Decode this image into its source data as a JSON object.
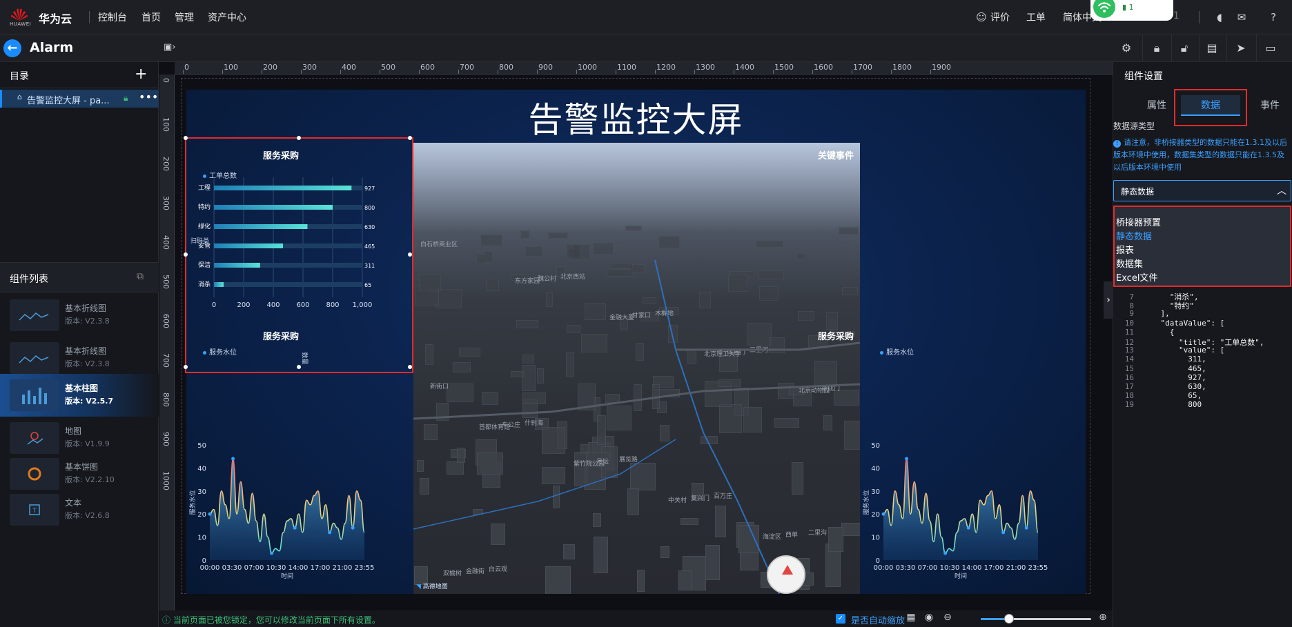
{
  "topbar": {
    "logo_text": "HUAWEI",
    "brand": "华为云",
    "nav": [
      "控制台",
      "首页",
      "管理",
      "资产中心"
    ],
    "rate_label": "评价",
    "ticket_label": "工单",
    "lang_label": "简体中文",
    "account_tail": "51",
    "wifi_badge": "1"
  },
  "secbar": {
    "page_name": "Alarm"
  },
  "left": {
    "dir_title": "目录",
    "page_item": "告警监控大屏 - pa...",
    "comp_title": "组件列表",
    "components": [
      {
        "name": "基本折线图",
        "version": "版本: V2.3.8"
      },
      {
        "name": "基本折线图",
        "version": "版本: V2.3.8"
      },
      {
        "name": "基本柱图",
        "version": "版本: V2.5.7"
      },
      {
        "name": "地图",
        "version": "版本: V1.9.9"
      },
      {
        "name": "基本饼图",
        "version": "版本: V2.2.10"
      },
      {
        "name": "文本",
        "version": "版本: V2.6.8"
      }
    ]
  },
  "ruler": {
    "top": [
      "0",
      "100",
      "200",
      "300",
      "400",
      "500",
      "600",
      "700",
      "800",
      "900",
      "1000",
      "1100",
      "1200",
      "1300",
      "1400",
      "1500",
      "1600",
      "1700",
      "1800",
      "1900"
    ],
    "left": [
      "0",
      "100",
      "200",
      "300",
      "400",
      "500",
      "600",
      "700",
      "800",
      "900",
      "1000"
    ]
  },
  "screen": {
    "title": "告警监控大屏",
    "bar_title": "服务采购",
    "bar_legend": "工单总数",
    "bar_side_label": "扫码类",
    "bar_axis_title": "数量",
    "left_line_title": "服务采购",
    "right_line_title": "服务采购",
    "line_legend": "服务水位",
    "line_ylabel": "服务水位",
    "line_xlabel": "时间",
    "key_events_title": "关键事件",
    "map_logo": "高德地图"
  },
  "chart_data": [
    {
      "type": "bar",
      "title": "服务采购",
      "orientation": "horizontal",
      "categories": [
        "工程",
        "特约",
        "绿化",
        "安管",
        "保洁",
        "消杀"
      ],
      "series": [
        {
          "name": "工单总数",
          "values": [
            927,
            800,
            630,
            465,
            311,
            65
          ]
        }
      ],
      "xlim": [
        0,
        1000
      ],
      "xticks": [
        "0",
        "200",
        "400",
        "600",
        "800",
        "1,000"
      ]
    },
    {
      "type": "area",
      "title": "服务采购",
      "legend": "服务水位",
      "xlabel": "时间",
      "ylabel": "服务水位",
      "ylim": [
        0,
        50
      ],
      "yticks": [
        "0",
        "10",
        "20",
        "30",
        "40",
        "50"
      ],
      "xticks": [
        "00:00",
        "03:30",
        "07:00",
        "10:30",
        "14:00",
        "17:00",
        "21:00",
        "23:55"
      ],
      "values": [
        20,
        22,
        15,
        30,
        24,
        18,
        44,
        20,
        34,
        22,
        16,
        29,
        17,
        8,
        20,
        10,
        3,
        5,
        4,
        12,
        17,
        18,
        14,
        20,
        12,
        26,
        24,
        28,
        30,
        18,
        24,
        12,
        16,
        14,
        9,
        16,
        28,
        14,
        30,
        26,
        12
      ]
    },
    {
      "type": "area",
      "title": "服务采购",
      "legend": "服务水位",
      "xlabel": "时间",
      "ylabel": "服务水位",
      "ylim": [
        0,
        50
      ],
      "yticks": [
        "0",
        "10",
        "20",
        "30",
        "40",
        "50"
      ],
      "xticks": [
        "00:00",
        "03:30",
        "07:00",
        "10:30",
        "14:00",
        "17:00",
        "21:00",
        "23:55"
      ],
      "values": [
        20,
        22,
        15,
        30,
        24,
        18,
        44,
        20,
        34,
        22,
        16,
        29,
        17,
        8,
        20,
        10,
        3,
        5,
        4,
        12,
        17,
        18,
        14,
        20,
        12,
        26,
        24,
        28,
        30,
        18,
        24,
        12,
        16,
        14,
        9,
        16,
        28,
        14,
        30,
        26,
        12
      ]
    }
  ],
  "right": {
    "title": "组件设置",
    "tabs": [
      "属性",
      "数据",
      "事件"
    ],
    "src_label": "数据源类型",
    "src_note": "请注意，非桥接器类型的数据只能在1.3.1及以后版本环境中使用，数据集类型的数据只能在1.3.5及以后版本环境中使用",
    "src_value": "静态数据",
    "options": [
      "桥接器预置",
      "静态数据",
      "报表",
      "数据集",
      "Excel文件"
    ],
    "code_lines": [
      {
        "n": "7",
        "t": "      \"消杀\","
      },
      {
        "n": "8",
        "t": "      \"特约\""
      },
      {
        "n": "9",
        "t": "    ],"
      },
      {
        "n": "10",
        "t": "    \"dataValue\": ["
      },
      {
        "n": "11",
        "t": "      {"
      },
      {
        "n": "12",
        "t": "        \"title\": \"工单总数\","
      },
      {
        "n": "13",
        "t": "        \"value\": ["
      },
      {
        "n": "14",
        "t": "          311,"
      },
      {
        "n": "15",
        "t": "          465,"
      },
      {
        "n": "16",
        "t": "          927,"
      },
      {
        "n": "17",
        "t": "          630,"
      },
      {
        "n": "18",
        "t": "          65,"
      },
      {
        "n": "19",
        "t": "          800"
      }
    ]
  },
  "status": {
    "text": "当前页面已被您锁定，您可以修改当前页面下所有设置。",
    "autoscale": "是否自动缩放"
  },
  "map_labels": [
    "白石桥商业区",
    "东方家园",
    "金融大厦",
    "北京理工大学",
    "北京动物园",
    "首都体育馆",
    "紫竹院公园",
    "中关村",
    "海淀区",
    "双榆树",
    "魏公村",
    "甘家口",
    "西直门",
    "阜成门",
    "车公庄",
    "月坛",
    "复兴门",
    "西单",
    "金融街",
    "北京西站",
    "木樨地",
    "三里河",
    "新街口",
    "什刹海",
    "展览路",
    "百万庄",
    "二里沟",
    "白云观"
  ]
}
